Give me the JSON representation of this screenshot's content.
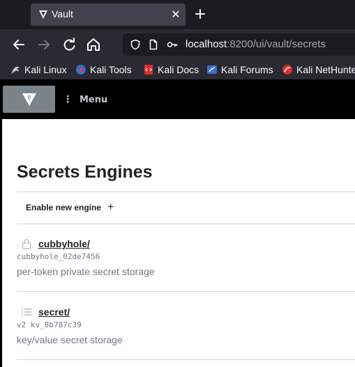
{
  "browser": {
    "tab_title": "Vault",
    "url_host": "localhost",
    "url_path": ":8200/ui/vault/secrets",
    "bookmarks": [
      {
        "label": "Kali Linux",
        "icon": "kali-dragon-icon"
      },
      {
        "label": "Kali Tools",
        "icon": "kali-tools-icon"
      },
      {
        "label": "Kali Docs",
        "icon": "kali-docs-icon"
      },
      {
        "label": "Kali Forums",
        "icon": "kali-forums-icon"
      },
      {
        "label": "Kali NetHunter",
        "icon": "kali-nethunter-icon"
      }
    ]
  },
  "header": {
    "menu_label": "Menu"
  },
  "page": {
    "title": "Secrets Engines",
    "enable_engine_label": "Enable new engine",
    "engines": [
      {
        "path": "cubbyhole/",
        "accessor": "cubbyhole_02de7456",
        "description": "per-token private secret storage",
        "icon": "lock-icon"
      },
      {
        "path": "secret/",
        "accessor": "v2 kv_8b787c39",
        "description": "key/value secret storage",
        "icon": "list-icon"
      }
    ]
  },
  "colors": {
    "tabstrip": "#1c1b22",
    "toolbar": "#2b2a33",
    "vault_header": "#000000",
    "text_primary": "#1f2124",
    "text_muted": "#6f7682"
  }
}
